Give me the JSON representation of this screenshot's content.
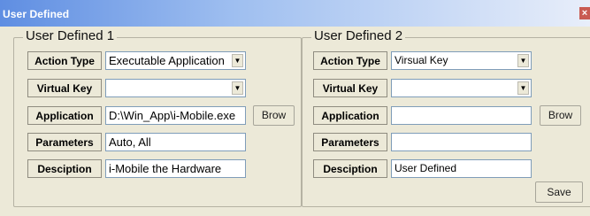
{
  "window": {
    "title": "User Defined",
    "close_glyph": "×"
  },
  "group1": {
    "title": "User Defined 1",
    "action_type_label": "Action Type",
    "action_type_value": "Executable Application",
    "virtual_key_label": "Virtual Key",
    "virtual_key_value": "",
    "application_label": "Application",
    "application_value": "D:\\Win_App\\i-Mobile.exe",
    "browse_label": "Brow",
    "parameters_label": "Parameters",
    "parameters_value": "Auto, All",
    "description_label": "Desciption",
    "description_value": "i-Mobile the Hardware"
  },
  "group2": {
    "title": "User Defined 2",
    "action_type_label": "Action Type",
    "action_type_value": "Virsual Key",
    "virtual_key_label": "Virtual Key",
    "virtual_key_value": "",
    "application_label": "Application",
    "application_value": "",
    "browse_label": "Brow",
    "parameters_label": "Parameters",
    "parameters_value": "",
    "description_label": "Desciption",
    "description_value": "User Defined"
  },
  "footer": {
    "save_label": "Save"
  },
  "icons": {
    "dropdown_glyph": "▼"
  }
}
